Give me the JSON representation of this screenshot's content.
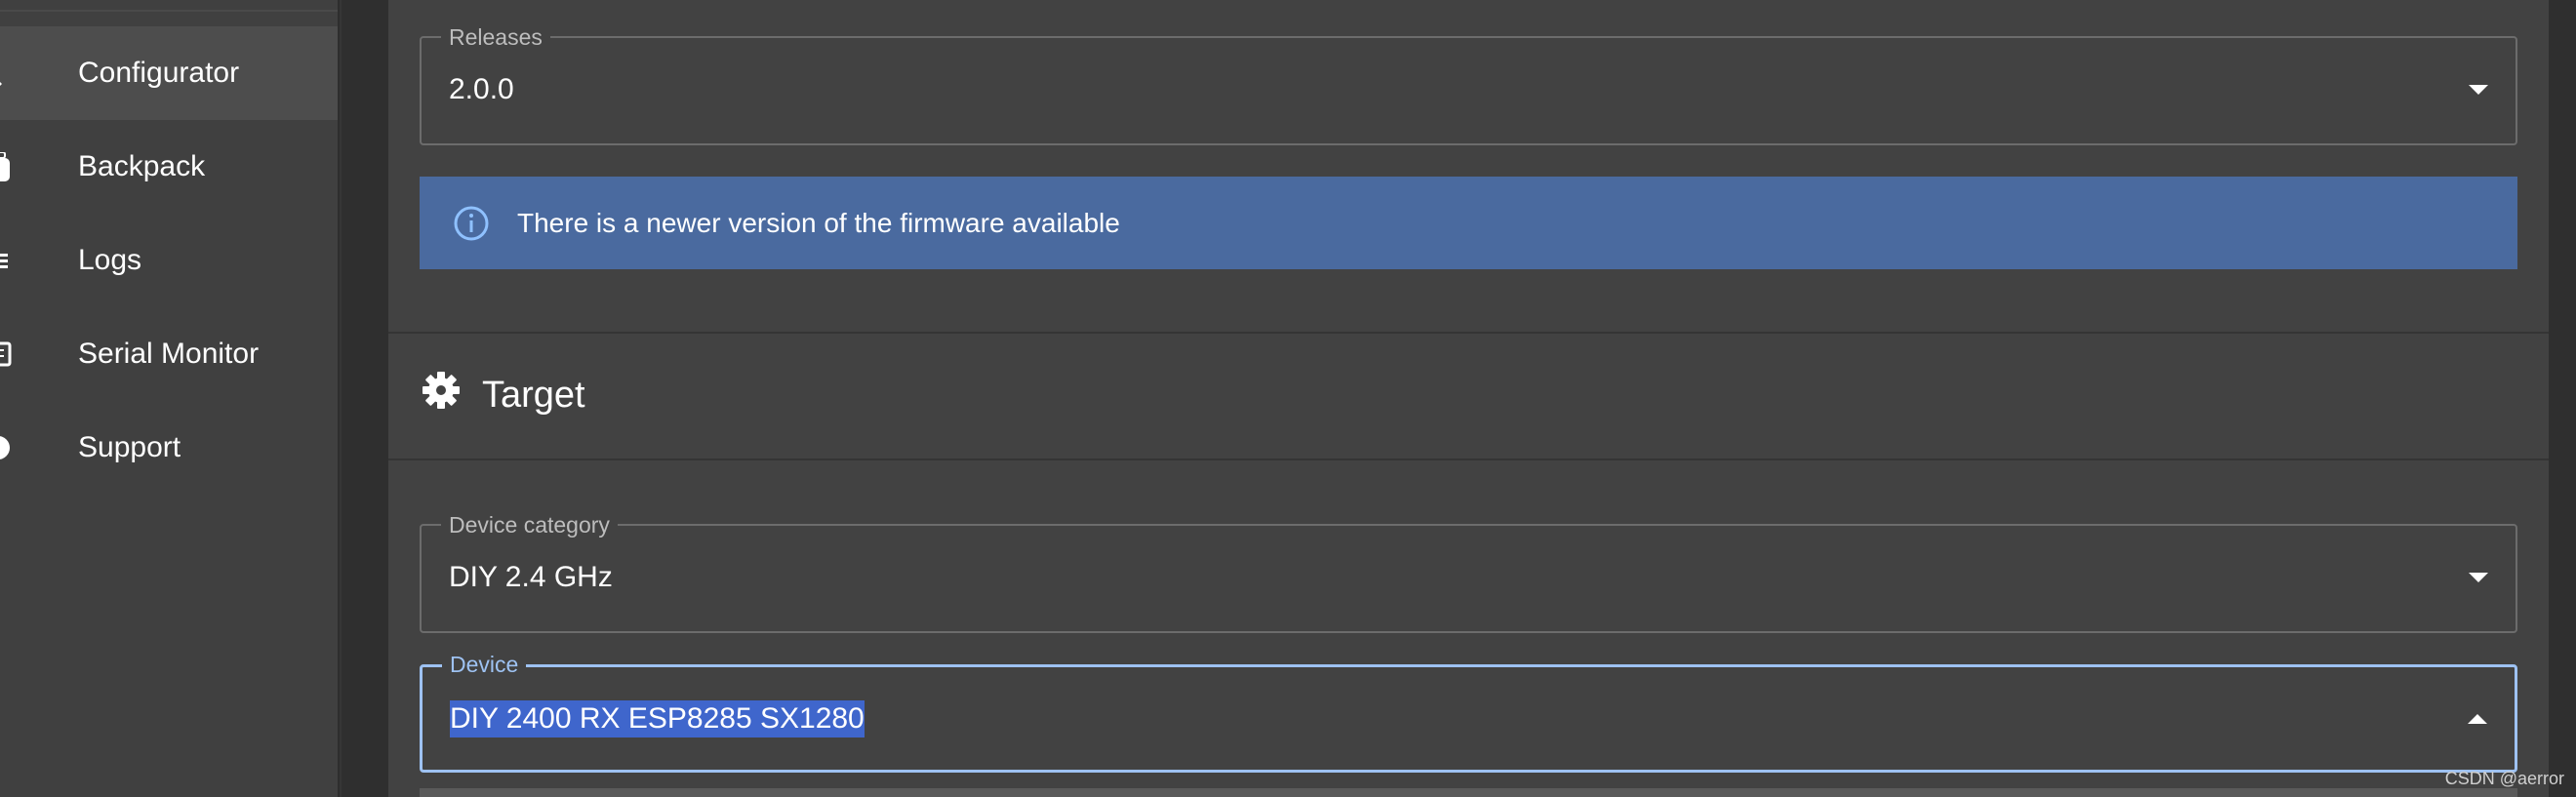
{
  "sidebar": {
    "items": [
      {
        "label": "Configurator",
        "icon": "wrench-icon",
        "active": true
      },
      {
        "label": "Backpack",
        "icon": "backpack-icon",
        "active": false
      },
      {
        "label": "Logs",
        "icon": "list-icon",
        "active": false
      },
      {
        "label": "Serial Monitor",
        "icon": "serial-monitor-icon",
        "active": false
      },
      {
        "label": "Support",
        "icon": "help-icon",
        "active": false
      }
    ]
  },
  "releases": {
    "label": "Releases",
    "value": "2.0.0"
  },
  "alert": {
    "text": "There is a newer version of the firmware available",
    "icon": "info-icon",
    "color": "#4a6a9f"
  },
  "target_section": {
    "title": "Target",
    "icon": "gear-icon"
  },
  "device_category": {
    "label": "Device category",
    "value": "DIY 2.4 GHz"
  },
  "device": {
    "label": "Device",
    "value": "DIY 2400 RX ESP8285 SX1280",
    "focused": true
  },
  "watermark": "CSDN @aerror",
  "colors": {
    "accent": "#9ec2f2",
    "selection": "#3f66cc"
  }
}
